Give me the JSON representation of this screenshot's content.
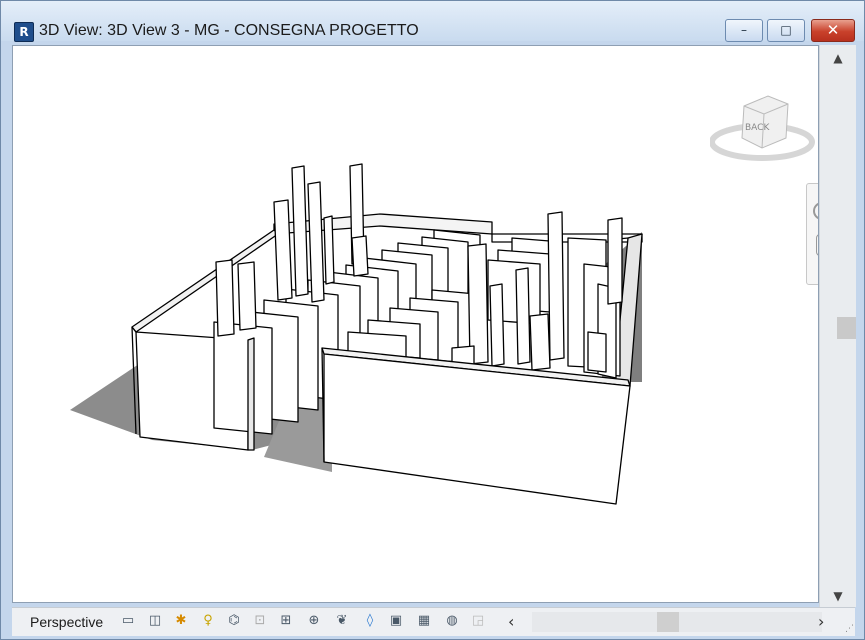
{
  "window": {
    "title": "3D View: 3D View 3 - MG - CONSEGNA PROGETTO",
    "app_icon_label": "R",
    "buttons": {
      "minimize": "–",
      "maximize": "□",
      "close": "✕"
    }
  },
  "viewcube": {
    "face_label": "BACK"
  },
  "status_bar": {
    "view_mode": "Perspective",
    "scroll_left": "‹",
    "scroll_right": "›",
    "icons": [
      "visual-style-icon",
      "detail-level-icon",
      "sun-path-icon",
      "shadows-icon",
      "render-icon",
      "crop-view-icon",
      "show-crop-icon",
      "lock-view-icon",
      "temp-hide-icon",
      "reveal-hidden-icon",
      "worksharing-icon",
      "design-options-icon",
      "analytical-model-icon",
      "highlight-displacement-icon"
    ]
  },
  "scrollbar": {
    "up": "▲",
    "down": "▼"
  },
  "colors": {
    "title_bar": "#c9dbef",
    "close_button": "#c9412b",
    "model_shadow": "#8f8f8f",
    "model_outline": "#000000"
  }
}
